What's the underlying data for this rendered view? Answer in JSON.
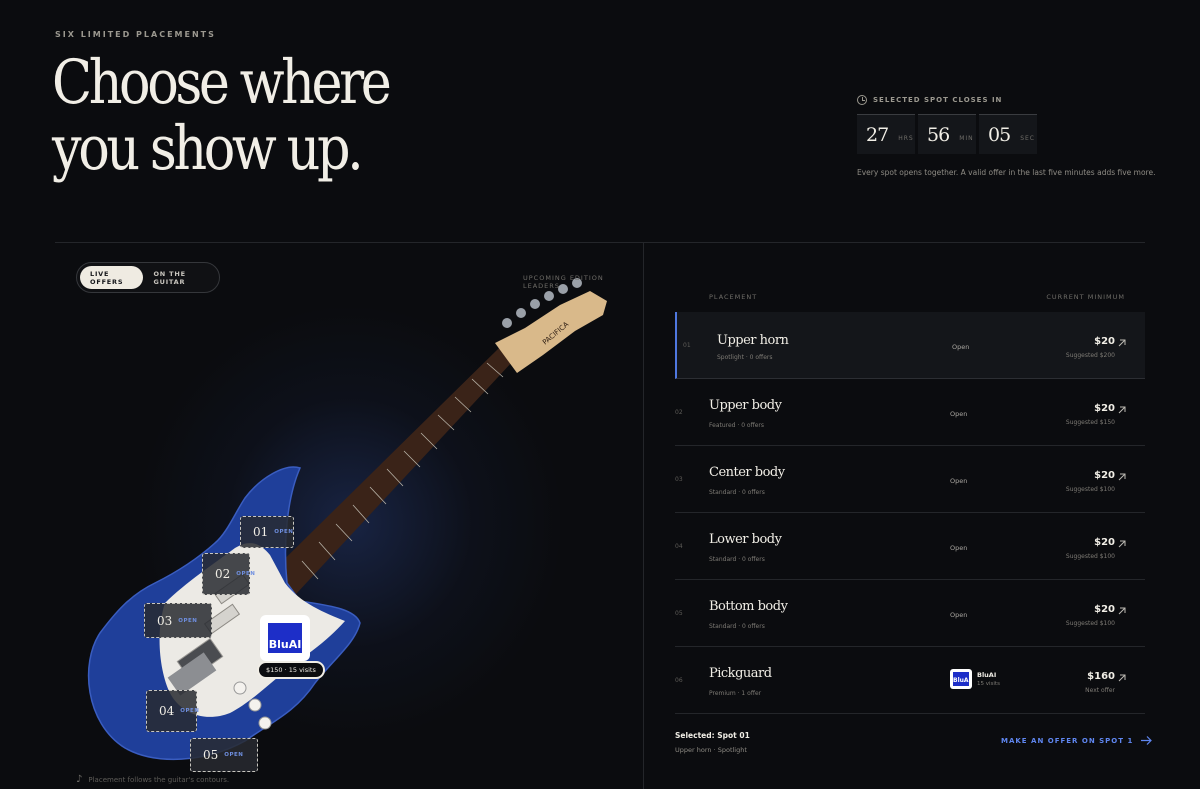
{
  "hero": {
    "eyebrow": "SIX LIMITED PLACEMENTS",
    "title_line1": "Choose where",
    "title_line2": "you show up."
  },
  "timer": {
    "label": "SELECTED SPOT CLOSES IN",
    "hours": "27",
    "hours_unit": "HRS",
    "minutes": "56",
    "minutes_unit": "MIN",
    "seconds": "05",
    "seconds_unit": "SEC",
    "note": "Every spot opens together. A valid offer in the last five minutes adds five more."
  },
  "stage": {
    "toggle_live": "LIVE OFFERS",
    "toggle_guitar": "ON THE GUITAR",
    "leaders_label": "UPCOMING EDITION LEADERS",
    "contour_note": "Placement follows the guitar's contours.",
    "headstock_text": "PACIFICA",
    "spots": [
      {
        "num": "01",
        "status": "OPEN"
      },
      {
        "num": "02",
        "status": "OPEN"
      },
      {
        "num": "03",
        "status": "OPEN"
      },
      {
        "num": "04",
        "status": "OPEN"
      },
      {
        "num": "05",
        "status": "OPEN"
      }
    ],
    "sponsor": {
      "logo": "BluAI",
      "price": "$150 · 15 visits"
    }
  },
  "table": {
    "col_placement": "PLACEMENT",
    "col_minimum": "CURRENT MINIMUM",
    "rows": [
      {
        "idx": "01",
        "name": "Upper horn",
        "sub": "Spotlight · 0 offers",
        "status": "Open",
        "price": "$20",
        "hint": "Suggested $200"
      },
      {
        "idx": "02",
        "name": "Upper body",
        "sub": "Featured · 0 offers",
        "status": "Open",
        "price": "$20",
        "hint": "Suggested $150"
      },
      {
        "idx": "03",
        "name": "Center body",
        "sub": "Standard · 0 offers",
        "status": "Open",
        "price": "$20",
        "hint": "Suggested $100"
      },
      {
        "idx": "04",
        "name": "Lower body",
        "sub": "Standard · 0 offers",
        "status": "Open",
        "price": "$20",
        "hint": "Suggested $100"
      },
      {
        "idx": "05",
        "name": "Bottom body",
        "sub": "Standard · 0 offers",
        "status": "Open",
        "price": "$20",
        "hint": "Suggested $100"
      },
      {
        "idx": "06",
        "name": "Pickguard",
        "sub": "Premium · 1 offer",
        "leader_logo": "BluAI",
        "leader_name": "BluAI",
        "leader_visits": "15 visits",
        "price": "$160",
        "hint": "Next offer"
      }
    ]
  },
  "footer": {
    "selected": "Selected: Spot 01",
    "selected_sub": "Upper horn · Spotlight",
    "cta": "MAKE AN OFFER ON SPOT 1"
  },
  "colors": {
    "background": "#0b0c0f",
    "accent": "#5f86f0",
    "guitar_body": "#1f3f9a",
    "sponsor_brand": "#1d2ec8"
  },
  "icons": [
    "clock-icon",
    "arrow-up-right-icon",
    "arrow-right-icon",
    "music-note-icon"
  ]
}
